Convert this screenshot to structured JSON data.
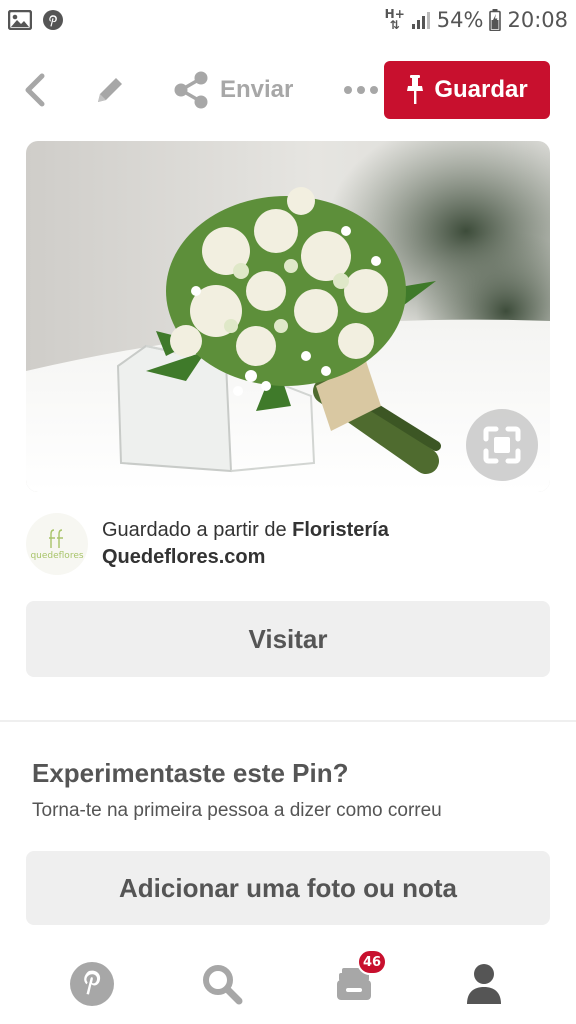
{
  "status_bar": {
    "left_icons": [
      "image-icon",
      "pinterest-icon"
    ],
    "network": "H+",
    "battery": "54%",
    "time": "20:08"
  },
  "toolbar": {
    "back_icon": "chevron-left-icon",
    "edit_icon": "pencil-icon",
    "share_label": "Enviar",
    "more_icon": "more-dots-icon",
    "save_label": "Guardar",
    "save_color": "#c8102e"
  },
  "pin": {
    "image_subject": "bridal-bouquet",
    "lens_icon": "visual-search-icon"
  },
  "source": {
    "avatar_text": "quedeflores",
    "prefix": "Guardado a partir de ",
    "name_line1": "Floristería",
    "name_line2": "Quedeflores.com"
  },
  "visit_label": "Visitar",
  "tried": {
    "title": "Experimentaste este Pin?",
    "subtitle": "Torna-te na primeira pessoa a dizer como correu",
    "add_label": "Adicionar uma foto ou nota"
  },
  "bottom_nav": {
    "items": [
      "pinterest-home-icon",
      "search-icon",
      "inbox-icon",
      "profile-icon"
    ],
    "inbox_badge": "46"
  }
}
